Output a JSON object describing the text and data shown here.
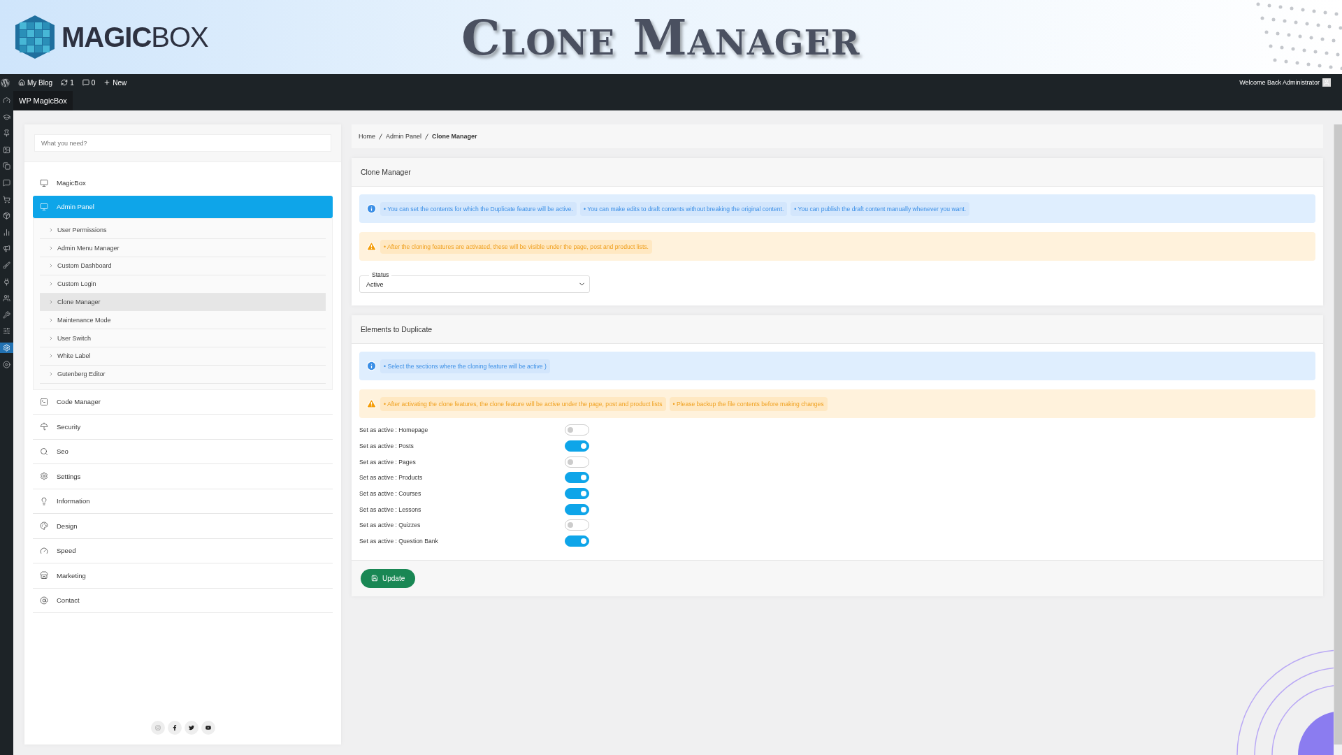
{
  "banner": {
    "logo": "**MAGIC**BOX",
    "title": "Clone Manager"
  },
  "admin_bar": {
    "items": [
      {
        "kind": "site",
        "label": "My Blog"
      },
      {
        "kind": "updates",
        "label": "1"
      },
      {
        "kind": "comments",
        "label": "0"
      },
      {
        "kind": "new",
        "label": "New"
      }
    ],
    "welcome": "Welcome Back Administrator",
    "app_title": "WP MagicBox"
  },
  "side_icons": [
    {
      "kind": "dashboard",
      "selected": false
    },
    {
      "kind": "courses",
      "selected": false
    },
    {
      "kind": "pin",
      "selected": false
    },
    {
      "kind": "media",
      "selected": false
    },
    {
      "kind": "pages",
      "selected": false
    },
    {
      "kind": "comments",
      "selected": false
    },
    {
      "kind": "shop",
      "selected": false
    },
    {
      "kind": "products",
      "selected": false
    },
    {
      "kind": "analytics",
      "selected": false
    },
    {
      "kind": "marketing",
      "selected": false
    },
    {
      "kind": "appearance",
      "selected": false
    },
    {
      "kind": "plugins",
      "selected": false
    },
    {
      "kind": "users",
      "selected": false
    },
    {
      "kind": "tools",
      "selected": false
    },
    {
      "kind": "settings-panel",
      "selected": false
    },
    {
      "kind": "gear",
      "selected": true
    },
    {
      "kind": "play",
      "selected": false
    }
  ],
  "sidebar": {
    "search": {
      "placeholder": "What you need?"
    },
    "items": [
      {
        "label": "MagicBox",
        "kind": "monitor",
        "selected": false
      },
      {
        "label": "Admin Panel",
        "kind": "monitor",
        "selected": true,
        "expanded": true,
        "children": [
          {
            "label": "User Permissions",
            "selected": false
          },
          {
            "label": "Admin Menu Manager",
            "selected": false
          },
          {
            "label": "Custom Dashboard",
            "selected": false
          },
          {
            "label": "Custom Login",
            "selected": false
          },
          {
            "label": "Clone Manager",
            "selected": true
          },
          {
            "label": "Maintenance Mode",
            "selected": false
          },
          {
            "label": "User Switch",
            "selected": false
          },
          {
            "label": "White Label",
            "selected": false
          },
          {
            "label": "Gutenberg Editor",
            "selected": false
          }
        ]
      },
      {
        "label": "Code Manager",
        "kind": "terminal",
        "selected": false
      },
      {
        "label": "Security",
        "kind": "umbrella",
        "selected": false
      },
      {
        "label": "Seo",
        "kind": "search",
        "selected": false
      },
      {
        "label": "Settings",
        "kind": "settings",
        "selected": false
      },
      {
        "label": "Information",
        "kind": "bulb",
        "selected": false
      },
      {
        "label": "Design",
        "kind": "palette",
        "selected": false
      },
      {
        "label": "Speed",
        "kind": "gauge",
        "selected": false
      },
      {
        "label": "Marketing",
        "kind": "store",
        "selected": false
      },
      {
        "label": "Contact",
        "kind": "at",
        "selected": false
      }
    ],
    "social": [
      {
        "kind": "instagram"
      },
      {
        "kind": "facebook"
      },
      {
        "kind": "twitter"
      },
      {
        "kind": "youtube"
      }
    ]
  },
  "breadcrumb": [
    {
      "label": "Home",
      "current": false
    },
    {
      "label": "Admin Panel",
      "current": false
    },
    {
      "label": "Clone Manager",
      "current": true
    }
  ],
  "panels": [
    {
      "title": "Clone Manager",
      "notices": [
        {
          "kind": "info",
          "items": [
            "• You can set the contents for which the Duplicate feature will be active.",
            "• You can make edits to draft contents without breaking the original content.",
            "• You can publish the draft content manually whenever you want."
          ]
        },
        {
          "kind": "warning",
          "items": [
            "• After the cloning features are activated, these will be visible under the page, post and product lists."
          ]
        }
      ],
      "status": {
        "label": "Status",
        "value": "Active"
      }
    },
    {
      "title": "Elements to Duplicate",
      "notices": [
        {
          "kind": "info",
          "items": [
            "• Select the sections where the cloning feature will be active )"
          ]
        },
        {
          "kind": "warning",
          "items": [
            "• After activating the clone features, the clone feature will be active under the page, post and product lists",
            "• Please backup the file contents before making changes"
          ]
        }
      ],
      "toggles": [
        {
          "label": "Set as active : Homepage",
          "on": false
        },
        {
          "label": "Set as active : Posts",
          "on": true
        },
        {
          "label": "Set as active : Pages",
          "on": false
        },
        {
          "label": "Set as active : Products",
          "on": true
        },
        {
          "label": "Set as active : Courses",
          "on": true
        },
        {
          "label": "Set as active : Lessons",
          "on": true
        },
        {
          "label": "Set as active : Quizzes",
          "on": false
        },
        {
          "label": "Set as active : Question Bank",
          "on": true
        }
      ],
      "button": "Update"
    }
  ]
}
